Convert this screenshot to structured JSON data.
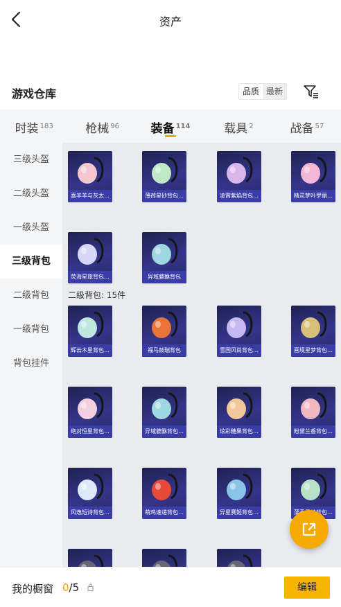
{
  "header": {
    "title": "资产"
  },
  "warehouse": {
    "title": "游戏仓库",
    "sort": {
      "options": [
        "品质",
        "最新"
      ],
      "active": "最新"
    }
  },
  "tabs": [
    {
      "label": "时装",
      "count": "183",
      "active": false
    },
    {
      "label": "枪械",
      "count": "96",
      "active": false
    },
    {
      "label": "装备",
      "count": "114",
      "active": true
    },
    {
      "label": "载具",
      "count": "2",
      "active": false
    },
    {
      "label": "战备",
      "count": "57",
      "active": false
    }
  ],
  "sidebar": {
    "items": [
      {
        "label": "三级头盔",
        "active": false
      },
      {
        "label": "二级头盔",
        "active": false
      },
      {
        "label": "一级头盔",
        "active": false
      },
      {
        "label": "三级背包",
        "active": true
      },
      {
        "label": "二级背包",
        "active": false
      },
      {
        "label": "一级背包",
        "active": false
      },
      {
        "label": "背包挂件",
        "active": false
      }
    ]
  },
  "groups": {
    "level3_items": [
      {
        "name": "喜羊羊与灰太…",
        "icon": "bunny-backpack",
        "color": "#f4c6d0"
      },
      {
        "name": "薄荷星砂背包…",
        "icon": "mint-backpack",
        "color": "#bfe8c4"
      },
      {
        "name": "凌霄紫焰背包…",
        "icon": "purple-flame-backpack",
        "color": "#d9b6ea"
      },
      {
        "name": "精灵梦叶罗丽…",
        "icon": "fairy-heart-backpack",
        "color": "#f2b8d6"
      },
      {
        "name": "荧海星旅背包…",
        "icon": "star-shell-backpack",
        "color": "#d8d6f6"
      },
      {
        "name": "异域貔貅背包",
        "icon": "mech-backpack",
        "color": "#9fd8e0"
      }
    ],
    "level2_label": "二级背包: 15件",
    "level2_items": [
      {
        "name": "辉云木星背包…",
        "icon": "cloud-bunny-backpack",
        "color": "#bfe6e0"
      },
      {
        "name": "福马鼓瑞背包",
        "icon": "horse-backpack",
        "color": "#e8743a"
      },
      {
        "name": "雪国风尚背包…",
        "icon": "snow-cap-backpack",
        "color": "#c6b8f0"
      },
      {
        "name": "画境星梦背包…",
        "icon": "lantern-backpack",
        "color": "#d8c07a"
      },
      {
        "name": "绝对恒星背包…",
        "icon": "popcorn-backpack",
        "color": "#f4cfe0"
      },
      {
        "name": "异域貔貅背包…",
        "icon": "mech-backpack",
        "color": "#9fd8e0"
      },
      {
        "name": "炫彩糖果背包…",
        "icon": "candy-backpack",
        "color": "#f0c89a"
      },
      {
        "name": "粉黛兰香背包…",
        "icon": "pink-crystal-backpack",
        "color": "#f2b8c2"
      },
      {
        "name": "风逸短诗背包…",
        "icon": "box-backpack",
        "color": "#dceaf8"
      },
      {
        "name": "萌鸡速递背包…",
        "icon": "chick-backpack",
        "color": "#e84a3a"
      },
      {
        "name": "异星赛姬背包…",
        "icon": "alien-rabbit-backpack",
        "color": "#8ac4e8"
      },
      {
        "name": "蒲秀雪蛙背包…",
        "icon": "frog-backpack",
        "color": "#b8e2c6"
      },
      {
        "name": "",
        "icon": "dark-backpack",
        "color": "#667"
      },
      {
        "name": "",
        "icon": "dark-backpack",
        "color": "#667"
      },
      {
        "name": "",
        "icon": "dark-backpack",
        "color": "#667"
      }
    ]
  },
  "showcase": {
    "label": "我的橱窗",
    "current": "0",
    "total": "/5"
  },
  "edit_button": {
    "label": "编辑"
  },
  "accent": "#f5a500"
}
